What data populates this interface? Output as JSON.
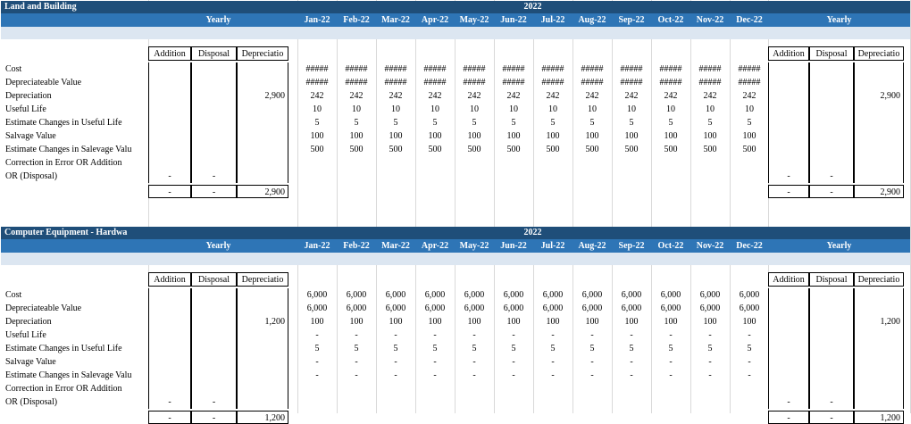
{
  "sections": [
    {
      "title": "Land and Building",
      "year": "2022",
      "yearly_label": "Yearly",
      "months": [
        "Jan-22",
        "Feb-22",
        "Mar-22",
        "Apr-22",
        "May-22",
        "Jun-22",
        "Jul-22",
        "Aug-22",
        "Sep-22",
        "Oct-22",
        "Nov-22",
        "Dec-22"
      ],
      "sub_headers": [
        "Addition",
        "Disposal",
        "Depreciatio"
      ],
      "rows": [
        {
          "label": "Cost",
          "left": [
            "",
            "",
            ""
          ],
          "months": [
            "#####",
            "#####",
            "#####",
            "#####",
            "#####",
            "#####",
            "#####",
            "#####",
            "#####",
            "#####",
            "#####",
            "#####"
          ],
          "right": [
            "",
            "",
            ""
          ]
        },
        {
          "label": "Depreciateable Value",
          "left": [
            "",
            "",
            ""
          ],
          "months": [
            "#####",
            "#####",
            "#####",
            "#####",
            "#####",
            "#####",
            "#####",
            "#####",
            "#####",
            "#####",
            "#####",
            "#####"
          ],
          "right": [
            "",
            "",
            ""
          ]
        },
        {
          "label": "Depreciation",
          "left": [
            "",
            "",
            "2,900"
          ],
          "months": [
            "242",
            "242",
            "242",
            "242",
            "242",
            "242",
            "242",
            "242",
            "242",
            "242",
            "242",
            "242"
          ],
          "right": [
            "",
            "",
            "2,900"
          ]
        },
        {
          "label": "Useful Life",
          "left": [
            "",
            "",
            ""
          ],
          "months": [
            "10",
            "10",
            "10",
            "10",
            "10",
            "10",
            "10",
            "10",
            "10",
            "10",
            "10",
            "10"
          ],
          "right": [
            "",
            "",
            ""
          ]
        },
        {
          "label": "Estimate Changes in Useful Life",
          "left": [
            "",
            "",
            ""
          ],
          "months": [
            "5",
            "5",
            "5",
            "5",
            "5",
            "5",
            "5",
            "5",
            "5",
            "5",
            "5",
            "5"
          ],
          "right": [
            "",
            "",
            ""
          ]
        },
        {
          "label": "Salvage Value",
          "left": [
            "",
            "",
            ""
          ],
          "months": [
            "100",
            "100",
            "100",
            "100",
            "100",
            "100",
            "100",
            "100",
            "100",
            "100",
            "100",
            "100"
          ],
          "right": [
            "",
            "",
            ""
          ]
        },
        {
          "label": "Estimate Changes in Salevage Valu",
          "left": [
            "",
            "",
            ""
          ],
          "months": [
            "500",
            "500",
            "500",
            "500",
            "500",
            "500",
            "500",
            "500",
            "500",
            "500",
            "500",
            "500"
          ],
          "right": [
            "",
            "",
            ""
          ]
        },
        {
          "label": "Correction in Error OR Addition",
          "left": [
            "",
            "",
            ""
          ],
          "months": [
            "",
            "",
            "",
            "",
            "",
            "",
            "",
            "",
            "",
            "",
            "",
            ""
          ],
          "right": [
            "",
            "",
            ""
          ]
        },
        {
          "label": "OR (Disposal)",
          "left": [
            "-",
            "-",
            ""
          ],
          "months": [
            "",
            "",
            "",
            "",
            "",
            "",
            "",
            "",
            "",
            "",
            "",
            ""
          ],
          "right": [
            "-",
            "-",
            ""
          ]
        }
      ],
      "totals": {
        "left": [
          "-",
          "-",
          "2,900"
        ],
        "right": [
          "-",
          "-",
          "2,900"
        ]
      }
    },
    {
      "title": "Computer Equipment - Hardwa",
      "year": "2022",
      "yearly_label": "Yearly",
      "months": [
        "Jan-22",
        "Feb-22",
        "Mar-22",
        "Apr-22",
        "May-22",
        "Jun-22",
        "Jul-22",
        "Aug-22",
        "Sep-22",
        "Oct-22",
        "Nov-22",
        "Dec-22"
      ],
      "sub_headers": [
        "Addition",
        "Disposal",
        "Depreciatio"
      ],
      "rows": [
        {
          "label": "Cost",
          "left": [
            "",
            "",
            ""
          ],
          "months": [
            "6,000",
            "6,000",
            "6,000",
            "6,000",
            "6,000",
            "6,000",
            "6,000",
            "6,000",
            "6,000",
            "6,000",
            "6,000",
            "6,000"
          ],
          "right": [
            "",
            "",
            ""
          ]
        },
        {
          "label": "Depreciateable Value",
          "left": [
            "",
            "",
            ""
          ],
          "months": [
            "6,000",
            "6,000",
            "6,000",
            "6,000",
            "6,000",
            "6,000",
            "6,000",
            "6,000",
            "6,000",
            "6,000",
            "6,000",
            "6,000"
          ],
          "right": [
            "",
            "",
            ""
          ]
        },
        {
          "label": "Depreciation",
          "left": [
            "",
            "",
            "1,200"
          ],
          "months": [
            "100",
            "100",
            "100",
            "100",
            "100",
            "100",
            "100",
            "100",
            "100",
            "100",
            "100",
            "100"
          ],
          "right": [
            "",
            "",
            "1,200"
          ]
        },
        {
          "label": "Useful Life",
          "left": [
            "",
            "",
            ""
          ],
          "months": [
            "-",
            "-",
            "-",
            "-",
            "-",
            "-",
            "-",
            "-",
            "-",
            "-",
            "-",
            "-"
          ],
          "right": [
            "",
            "",
            ""
          ]
        },
        {
          "label": "Estimate Changes in Useful Life",
          "left": [
            "",
            "",
            ""
          ],
          "months": [
            "5",
            "5",
            "5",
            "5",
            "5",
            "5",
            "5",
            "5",
            "5",
            "5",
            "5",
            "5"
          ],
          "right": [
            "",
            "",
            ""
          ]
        },
        {
          "label": "Salvage Value",
          "left": [
            "",
            "",
            ""
          ],
          "months": [
            "-",
            "-",
            "-",
            "-",
            "-",
            "-",
            "-",
            "-",
            "-",
            "-",
            "-",
            "-"
          ],
          "right": [
            "",
            "",
            ""
          ]
        },
        {
          "label": "Estimate Changes in Salevage Valu",
          "left": [
            "",
            "",
            ""
          ],
          "months": [
            "-",
            "-",
            "-",
            "-",
            "-",
            "-",
            "-",
            "-",
            "-",
            "-",
            "-",
            "-"
          ],
          "right": [
            "",
            "",
            ""
          ]
        },
        {
          "label": "Correction in Error OR Addition",
          "left": [
            "",
            "",
            ""
          ],
          "months": [
            "",
            "",
            "",
            "",
            "",
            "",
            "",
            "",
            "",
            "",
            "",
            ""
          ],
          "right": [
            "",
            "",
            ""
          ]
        },
        {
          "label": "OR (Disposal)",
          "left": [
            "-",
            "-",
            ""
          ],
          "months": [
            "",
            "",
            "",
            "",
            "",
            "",
            "",
            "",
            "",
            "",
            "",
            ""
          ],
          "right": [
            "-",
            "-",
            ""
          ]
        }
      ],
      "totals": {
        "left": [
          "-",
          "-",
          "1,200"
        ],
        "right": [
          "-",
          "-",
          "1,200"
        ]
      }
    }
  ]
}
